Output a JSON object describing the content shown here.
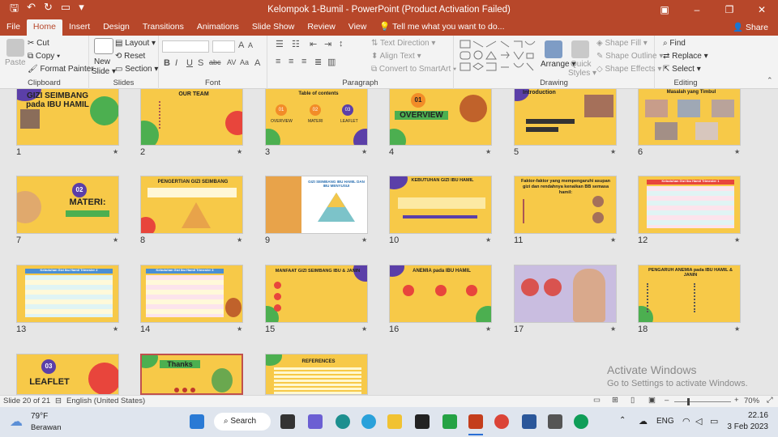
{
  "window": {
    "title": "Kelompok 1-Bumil  -  PowerPoint (Product Activation Failed)",
    "qa_icons": [
      "save-icon",
      "undo-icon",
      "redo-icon",
      "present-icon",
      "customize-icon"
    ],
    "brand_color": "#b7472a"
  },
  "tabs": [
    "File",
    "Home",
    "Insert",
    "Design",
    "Transitions",
    "Animations",
    "Slide Show",
    "Review",
    "View"
  ],
  "active_tab": "Home",
  "tell_me": "Tell me what you want to do...",
  "share": "Share",
  "ribbon": {
    "clipboard": {
      "label": "Clipboard",
      "paste": "Paste",
      "cut": "Cut",
      "copy": "Copy",
      "format_painter": "Format Painter"
    },
    "slides": {
      "label": "Slides",
      "new_slide": "New",
      "new_slide2": "Slide",
      "layout": "Layout",
      "reset": "Reset",
      "section": "Section"
    },
    "font": {
      "label": "Font",
      "buttons": [
        "B",
        "I",
        "U",
        "S",
        "abc",
        "AV",
        "Aa",
        "A",
        "A"
      ]
    },
    "paragraph": {
      "label": "Paragraph",
      "text_direction": "Text Direction",
      "align_text": "Align Text",
      "smartart": "Convert to SmartArt"
    },
    "drawing": {
      "label": "Drawing",
      "arrange": "Arrange",
      "quick_styles": "Quick",
      "quick_styles2": "Styles",
      "shape_fill": "Shape Fill",
      "shape_outline": "Shape Outline",
      "shape_effects": "Shape Effects"
    },
    "editing": {
      "label": "Editing",
      "find": "Find",
      "replace": "Replace",
      "select": "Select"
    }
  },
  "slides": [
    {
      "n": "1",
      "title": "GIZI SEIMBANG pada IBU HAMIL",
      "bg": "#f7c948"
    },
    {
      "n": "2",
      "title": "OUR TEAM",
      "bg": "#f7c948"
    },
    {
      "n": "3",
      "title": "Table of contents",
      "bg": "#f7c948",
      "items": [
        "01",
        "02",
        "03",
        "OVERVIEW",
        "MATERI",
        "LEAFLET"
      ]
    },
    {
      "n": "4",
      "title": "OVERVIEW",
      "bg": "#f7c948",
      "sub": "01"
    },
    {
      "n": "5",
      "title": "Introduction",
      "bg": "#f7c948"
    },
    {
      "n": "6",
      "title": "Masalah yang Timbul",
      "bg": "#f7c948"
    },
    {
      "n": "7",
      "title": "MATERI:",
      "bg": "#f7c948",
      "sub": "02"
    },
    {
      "n": "8",
      "title": "PENGERTIAN GIZI SEIMBANG",
      "bg": "#f7c948"
    },
    {
      "n": "9",
      "title": "GIZI SEIMBANG IBU HAMIL DAN IBU MENYUSUI",
      "bg": "#ffffff"
    },
    {
      "n": "10",
      "title": "KEBUTUHAN GIZI IBU HAMIL",
      "bg": "#f7c948"
    },
    {
      "n": "11",
      "title": "Faktor-faktor yang mempengaruhi asupan gizi dan rendahnya kenaikan BB semasa hamil:",
      "bg": "#f7c948"
    },
    {
      "n": "12",
      "title": "Kebutuhan Gizi Ibu Hamil Trimester 1",
      "bg": "#f7c948"
    },
    {
      "n": "13",
      "title": "Kebutuhan Gizi Ibu Hamil Trimester 2",
      "bg": "#f7c948"
    },
    {
      "n": "14",
      "title": "Kebutuhan Gizi Ibu Hamil Trimester 3",
      "bg": "#f7c948"
    },
    {
      "n": "15",
      "title": "MANFAAT GIZI SEIMBANG IBU & JANIN",
      "bg": "#f7c948"
    },
    {
      "n": "16",
      "title": "ANEMIA pada IBU HAMIL",
      "bg": "#f7c948"
    },
    {
      "n": "17",
      "title": "",
      "bg": "#c9bde0"
    },
    {
      "n": "18",
      "title": "PENGARUH ANEMIA pada IBU HAMIL & JANIN",
      "bg": "#f7c948"
    },
    {
      "n": "19",
      "title": "LEAFLET",
      "bg": "#f7c948",
      "sub": "03"
    },
    {
      "n": "20",
      "title": "Thanks",
      "bg": "#f7c948"
    },
    {
      "n": "21",
      "title": "REFERENCES",
      "bg": "#f7c948"
    }
  ],
  "watermark": {
    "line1": "Activate Windows",
    "line2": "Go to Settings to activate Windows."
  },
  "status": {
    "slide_count": "Slide 20 of 21",
    "language": "English (United States)",
    "zoom": "70%"
  },
  "taskbar": {
    "temp": "79°F",
    "weather": "Berawan",
    "search": "Search",
    "lang": "ENG",
    "time": "22.16",
    "date": "3 Feb 2023"
  }
}
